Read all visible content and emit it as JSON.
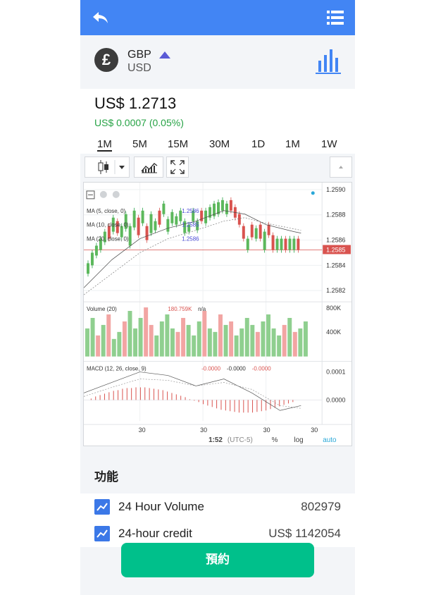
{
  "pair": {
    "base": "GBP",
    "quote": "USD",
    "coin_symbol": "£"
  },
  "price": {
    "value": "US$ 1.2713",
    "change": "US$ 0.0007 (0.05%)"
  },
  "timeframes": [
    "1M",
    "5M",
    "15M",
    "30M",
    "1D",
    "1M",
    "1W"
  ],
  "active_timeframe": 0,
  "chart": {
    "price_axis": [
      "1.2590",
      "1.2588",
      "1.2586",
      "1.2584",
      "1.2582"
    ],
    "current_price_tag": "1.2585",
    "ma_labels": [
      {
        "name": "MA (5, close, 0)",
        "value": "1.2586"
      },
      {
        "name": "MA (10, close, 0)",
        "value": "1.2585"
      },
      {
        "name": "MA (20, close, 0)",
        "value": "1.2586"
      }
    ],
    "volume_label": "Volume (20)",
    "volume_value": "180.759K",
    "volume_na": "n/a",
    "volume_axis": [
      "800K",
      "400K"
    ],
    "macd_label": "MACD (12, 26, close, 9)",
    "macd_values": [
      "-0.0000",
      "-0.0000",
      "-0.0000"
    ],
    "macd_axis": [
      "0.0001",
      "0.0000"
    ],
    "x_ticks": [
      "30",
      "30",
      "30",
      "30"
    ],
    "time_label": "1:52",
    "timezone": "(UTC-5)",
    "pct_btn": "%",
    "log_btn": "log",
    "auto_btn": "auto"
  },
  "section_title": "功能",
  "stats": [
    {
      "label": "24 Hour Volume",
      "value": "802979"
    },
    {
      "label": "24-hour credit",
      "value": "US$ 1142054"
    }
  ],
  "book_button": "預約",
  "colors": {
    "header": "#4285f4",
    "up": "#27a346",
    "down": "#d9534f",
    "book": "#00c08b"
  }
}
